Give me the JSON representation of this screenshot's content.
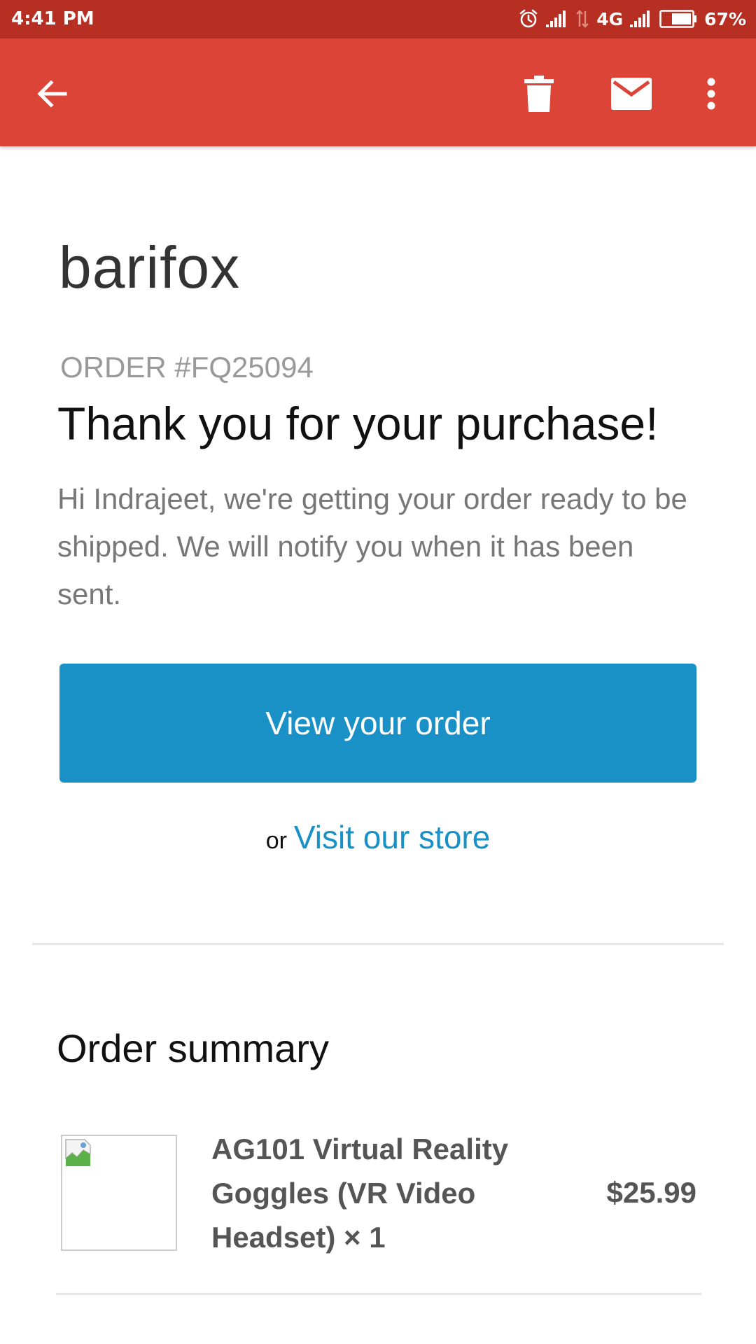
{
  "status_bar": {
    "time": "4:41 PM",
    "network": "4G",
    "battery": "67%",
    "icons": [
      "alarm-icon",
      "signal-icon",
      "data-transfer-icon",
      "signal-icon",
      "battery-icon"
    ]
  },
  "app_bar": {
    "icons": [
      "back-arrow-icon",
      "trash-icon",
      "mail-icon",
      "more-vert-icon"
    ]
  },
  "email": {
    "shop_name": "barifox",
    "order_number": "ORDER #FQ25094",
    "headline": "Thank you for your purchase!",
    "intro": "Hi Indrajeet, we're getting your order ready to be shipped. We will notify you when it has been sent.",
    "view_order_button": "View your order",
    "or_text": "or",
    "store_link": "Visit our store",
    "summary_title": "Order summary",
    "items": [
      {
        "name": "AG101 Virtual Reality Goggles (VR Video Headset) × 1",
        "price": "$25.99",
        "image": "broken-image-icon"
      }
    ]
  },
  "colors": {
    "status_bar": "#b72f22",
    "app_bar": "#db4437",
    "accent": "#1990c6"
  }
}
